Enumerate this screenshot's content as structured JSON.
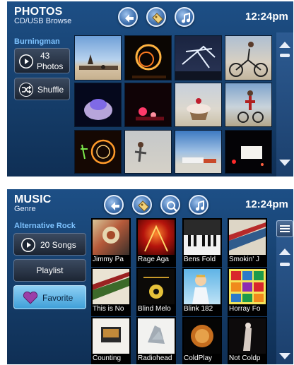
{
  "photos": {
    "title": "PHOTOS",
    "subtitle": "CD/USB Browse",
    "clock": "12:24pm",
    "folder": "Burningman",
    "count_number": "43",
    "count_label": "Photos",
    "shuffle_label": "Shuffle",
    "nav_icons": [
      "back-icon",
      "tag-icon",
      "music-note-icon"
    ]
  },
  "music": {
    "title": "MUSIC",
    "subtitle": "Genre",
    "clock": "12:24pm",
    "genre": "Alternative Rock",
    "songs_label": "20 Songs",
    "playlist_label": "Playlist",
    "favorite_label": "Favorite",
    "nav_icons": [
      "back-icon",
      "tag-icon",
      "search-icon",
      "music-note-icon"
    ],
    "albums": [
      "Jimmy Pa",
      "Rage Aga",
      "Bens Fold",
      "Smokin' J",
      "This is No",
      "Blind Melo",
      "Blink 182",
      "Horray Fo",
      "Counting",
      "Radiohead",
      "ColdPlay",
      "Not Coldp"
    ]
  },
  "colors": {
    "accent": "#7ec3ff",
    "background": "#1d4f86",
    "favorite": "#5bb7ec"
  }
}
